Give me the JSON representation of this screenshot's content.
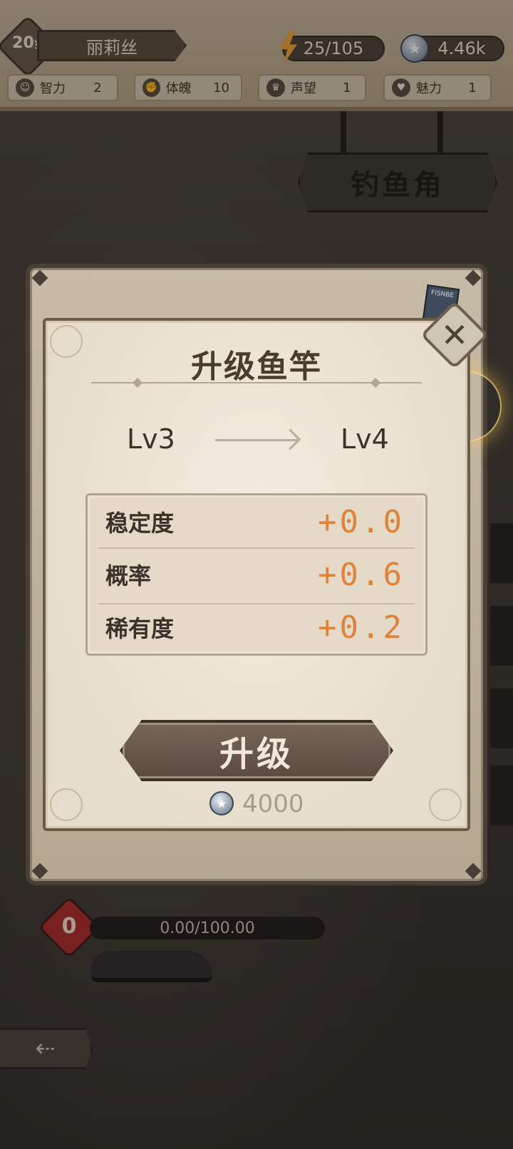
{
  "header": {
    "age": "20",
    "age_unit": "岁",
    "name": "丽莉丝",
    "energy": "25/105",
    "coins": "4.46k",
    "stats": [
      {
        "label": "智力",
        "value": "2",
        "icon": "brain-icon"
      },
      {
        "label": "体魄",
        "value": "10",
        "icon": "muscle-icon"
      },
      {
        "label": "声望",
        "value": "1",
        "icon": "laurel-icon"
      },
      {
        "label": "魅力",
        "value": "1",
        "icon": "heart-pulse-icon"
      }
    ]
  },
  "location": {
    "sign": "钓鱼角"
  },
  "modal": {
    "title": "升级鱼竿",
    "level_from": "Lv3",
    "level_to": "Lv4",
    "stats": [
      {
        "name": "稳定度",
        "value": "+0.0"
      },
      {
        "name": "概率",
        "value": "+0.6"
      },
      {
        "name": "稀有度",
        "value": "+0.2"
      }
    ],
    "upgrade_label": "升级",
    "cost": "4000",
    "card_text": "FISNBE"
  },
  "bottom": {
    "heart_count": "0",
    "hp_text": "0.00/100.00",
    "back_glyph": "⇠"
  },
  "colors": {
    "accent_orange": "#e0833a",
    "frame_brown": "#4a3f35",
    "paper": "#f3ecdf"
  }
}
